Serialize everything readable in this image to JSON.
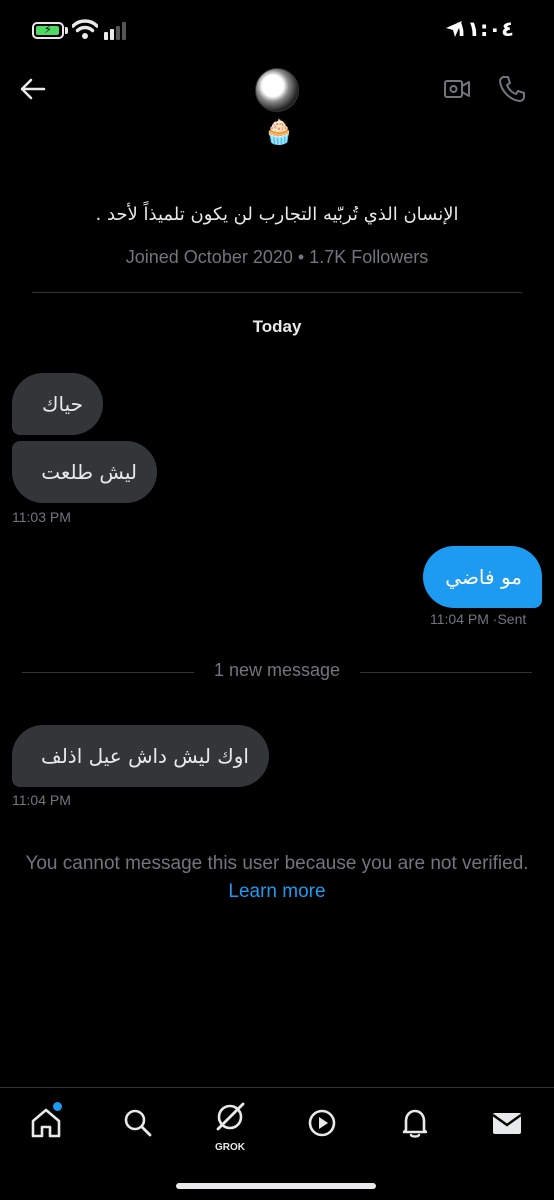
{
  "status_bar": {
    "time": "١١:٠٤",
    "battery_icon": "battery-charging-icon",
    "wifi_icon": "wifi-icon",
    "signal_icon": "cellular-signal-icon",
    "location_icon": "location-arrow-icon"
  },
  "header": {
    "back_icon": "arrow-left-icon",
    "avatar_icon": "profile-avatar",
    "badge_emoji": "🧁",
    "video_icon": "video-call-icon",
    "call_icon": "phone-icon"
  },
  "profile": {
    "bio": "الإنسان الذي تُربّيه التجارب لن يكون تلميذاً لأحد .",
    "meta": "Joined October 2020 • 1.7K Followers"
  },
  "conversation": {
    "day_label": "Today",
    "messages": [
      {
        "text": "حياك",
        "direction": "in"
      },
      {
        "text": "ليش طلعت",
        "direction": "in"
      },
      {
        "text": "مو فاضي",
        "direction": "out"
      },
      {
        "text": "اوك ليش داش عيل اذلف",
        "direction": "in"
      }
    ],
    "timestamps": {
      "first_group": "11:03 PM",
      "sent_group": "11:04 PM",
      "sent_status": "·Sent",
      "last_group": "11:04 PM"
    },
    "new_message_divider": "1 new message"
  },
  "notice": {
    "text": "You cannot message this user because you are not verified.",
    "link": "Learn more"
  },
  "bottom_nav": {
    "items": [
      {
        "icon": "home-icon"
      },
      {
        "icon": "search-icon"
      },
      {
        "icon": "grok-icon",
        "label": "GROK"
      },
      {
        "icon": "play-icon"
      },
      {
        "icon": "bell-icon"
      },
      {
        "icon": "mail-icon"
      }
    ]
  },
  "colors": {
    "background": "#000000",
    "accent": "#1d9bf0",
    "incoming_bubble": "#333639",
    "muted_text": "#71767b"
  }
}
